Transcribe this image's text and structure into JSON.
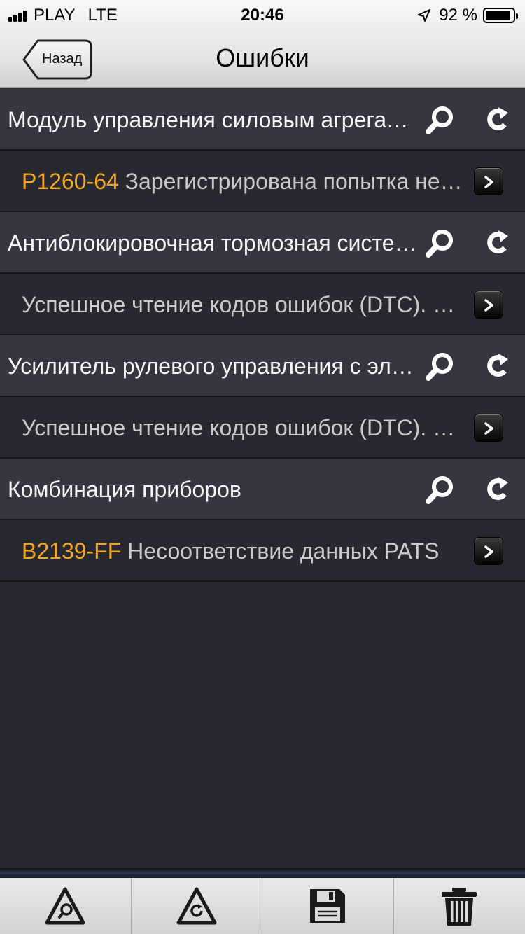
{
  "status_bar": {
    "carrier": "PLAY",
    "network": "LTE",
    "time": "20:46",
    "battery": "92 %",
    "battery_level": 0.92,
    "icons": [
      "signal-icon",
      "location-arrow-icon",
      "battery-icon"
    ]
  },
  "nav": {
    "back_label": "Назад",
    "title": "Ошибки"
  },
  "modules": [
    {
      "title": "Модуль управления силовым агрегатом",
      "items": [
        {
          "code": "P1260-64",
          "text": "Зарегистрирована попытка несанкционированного запуска"
        }
      ]
    },
    {
      "title": "Антиблокировочная тормозная система",
      "items": [
        {
          "code": "",
          "text": "Успешное чтение кодов ошибок (DTC). Ошибок не обнаружено"
        }
      ]
    },
    {
      "title": "Усилитель рулевого управления с электроприводом",
      "items": [
        {
          "code": "",
          "text": "Успешное чтение кодов ошибок (DTC). Ошибок не обнаружено"
        }
      ]
    },
    {
      "title": "Комбинация приборов",
      "items": [
        {
          "code": "B2139-FF",
          "text": "Несоответствие данных PATS"
        }
      ]
    }
  ],
  "row_icons": {
    "search": "search-icon",
    "refresh": "refresh-icon",
    "detail": "chevron-right-icon"
  },
  "toolbar": {
    "buttons": [
      {
        "name": "scan-all-button",
        "icon": "warning-search-icon"
      },
      {
        "name": "clear-all-button",
        "icon": "warning-refresh-icon"
      },
      {
        "name": "save-button",
        "icon": "floppy-disk-icon"
      },
      {
        "name": "delete-button",
        "icon": "trash-icon"
      }
    ]
  },
  "colors": {
    "background": "#272830",
    "group_row": "#353640",
    "dtc_code": "#f5a623",
    "item_text": "#c9c9c9"
  }
}
